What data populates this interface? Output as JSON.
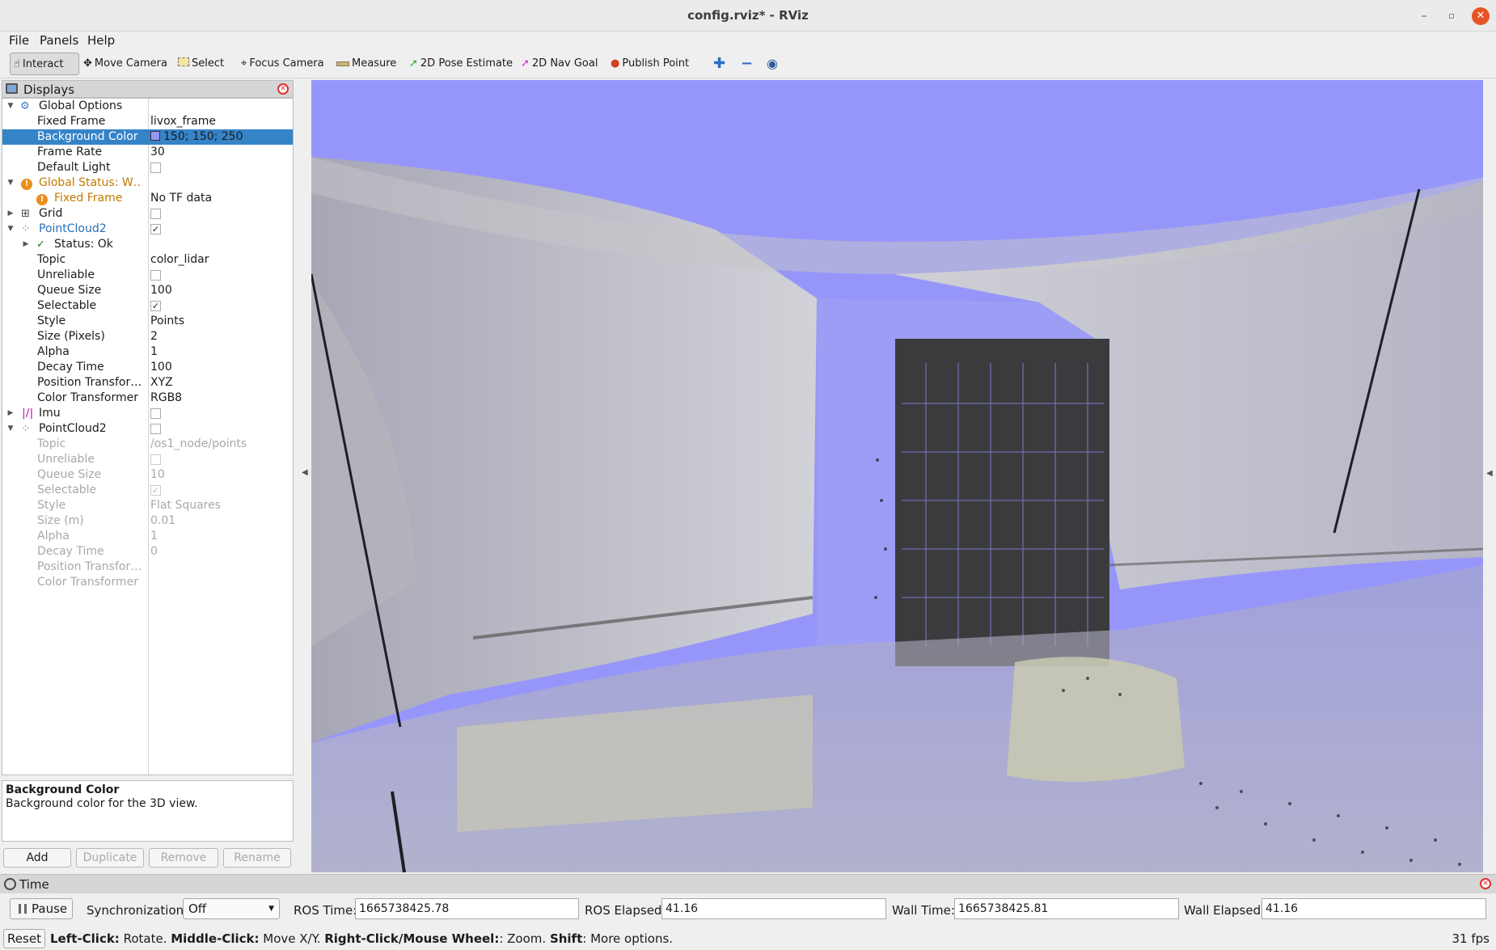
{
  "window": {
    "title": "config.rviz* - RViz"
  },
  "menu": [
    "File",
    "Panels",
    "Help"
  ],
  "toolbar": {
    "tools": [
      "Interact",
      "Move Camera",
      "Select",
      "Focus Camera",
      "Measure",
      "2D Pose Estimate",
      "2D Nav Goal",
      "Publish Point"
    ]
  },
  "displays": {
    "title": "Displays",
    "rows": [
      {
        "name": "Global Options",
        "value": ""
      },
      {
        "name": "Fixed Frame",
        "value": "livox_frame"
      },
      {
        "name": "Background Color",
        "value": "150; 150; 250"
      },
      {
        "name": "Frame Rate",
        "value": "30"
      },
      {
        "name": "Default Light",
        "value": ""
      },
      {
        "name": "Global Status: W…",
        "value": ""
      },
      {
        "name": "Fixed Frame",
        "value": "No TF data"
      },
      {
        "name": "Grid",
        "value": ""
      },
      {
        "name": "PointCloud2",
        "value": ""
      },
      {
        "name": "Status: Ok",
        "value": ""
      },
      {
        "name": "Topic",
        "value": "color_lidar"
      },
      {
        "name": "Unreliable",
        "value": ""
      },
      {
        "name": "Queue Size",
        "value": "100"
      },
      {
        "name": "Selectable",
        "value": ""
      },
      {
        "name": "Style",
        "value": "Points"
      },
      {
        "name": "Size (Pixels)",
        "value": "2"
      },
      {
        "name": "Alpha",
        "value": "1"
      },
      {
        "name": "Decay Time",
        "value": "100"
      },
      {
        "name": "Position Transfor…",
        "value": "XYZ"
      },
      {
        "name": "Color Transformer",
        "value": "RGB8"
      },
      {
        "name": "Imu",
        "value": ""
      },
      {
        "name": "PointCloud2",
        "value": ""
      },
      {
        "name": "Topic",
        "value": "/os1_node/points"
      },
      {
        "name": "Unreliable",
        "value": ""
      },
      {
        "name": "Queue Size",
        "value": "10"
      },
      {
        "name": "Selectable",
        "value": ""
      },
      {
        "name": "Style",
        "value": "Flat Squares"
      },
      {
        "name": "Size (m)",
        "value": "0.01"
      },
      {
        "name": "Alpha",
        "value": "1"
      },
      {
        "name": "Decay Time",
        "value": "0"
      },
      {
        "name": "Position Transfor…",
        "value": ""
      },
      {
        "name": "Color Transformer",
        "value": ""
      }
    ],
    "checks": {
      "default_light": false,
      "grid": false,
      "pc1_enabled": true,
      "pc1_unreliable": false,
      "pc1_selectable": true,
      "imu": false,
      "pc2_enabled": false,
      "pc2_unreliable": false,
      "pc2_selectable": true
    }
  },
  "description": {
    "title": "Background Color",
    "text": "Background color for the 3D view."
  },
  "panel_buttons": [
    "Add",
    "Duplicate",
    "Remove",
    "Rename"
  ],
  "colors": {
    "background": "#9696fa",
    "selection": "#3584c8",
    "warning": "#c47a00"
  },
  "time": {
    "title": "Time",
    "pause_label": "Pause",
    "sync_label": "Synchronization:",
    "sync_value": "Off",
    "ros_time_label": "ROS Time:",
    "ros_time": "1665738425.78",
    "ros_elapsed_label": "ROS Elapsed:",
    "ros_elapsed": "41.16",
    "wall_time_label": "Wall Time:",
    "wall_time": "1665738425.81",
    "wall_elapsed_label": "Wall Elapsed:",
    "wall_elapsed": "41.16"
  },
  "status": {
    "reset_label": "Reset",
    "hint_parts": [
      {
        "b": "Left-Click:",
        "t": " Rotate. "
      },
      {
        "b": "Middle-Click:",
        "t": " Move X/Y. "
      },
      {
        "b": "Right-Click/Mouse Wheel:",
        "t": ": Zoom. "
      },
      {
        "b": "Shift",
        "t": ": More options."
      }
    ],
    "fps": "31 fps"
  }
}
